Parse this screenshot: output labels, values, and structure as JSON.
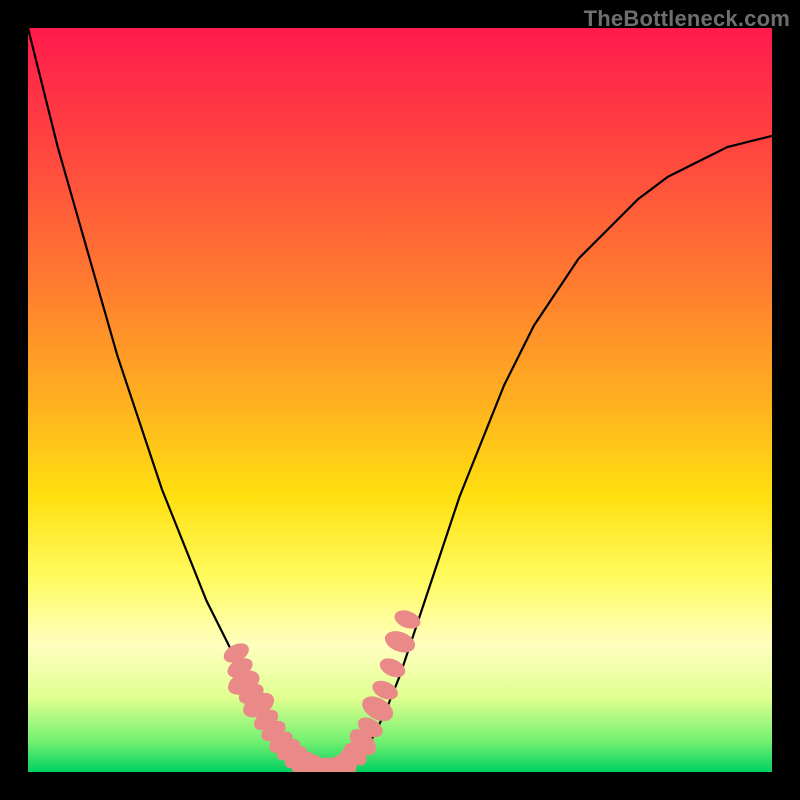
{
  "watermark": "TheBottleneck.com",
  "colors": {
    "frame": "#000000",
    "curve": "#000000",
    "marker": "#e98a88",
    "gradient_stops": [
      "#ff1a4d",
      "#ff4a3e",
      "#ff7a30",
      "#ffb020",
      "#ffe010",
      "#fffb60",
      "#ffffc0",
      "#e0ff90",
      "#70f070",
      "#00d060"
    ]
  },
  "chart_data": {
    "type": "line",
    "title": "",
    "xlabel": "",
    "ylabel": "",
    "xlim": [
      0,
      100
    ],
    "ylim": [
      0,
      100
    ],
    "x": [
      0,
      2,
      4,
      6,
      8,
      10,
      12,
      14,
      16,
      18,
      20,
      22,
      24,
      26,
      28,
      30,
      32,
      34,
      36,
      38,
      40,
      42,
      44,
      46,
      48,
      50,
      52,
      54,
      56,
      58,
      60,
      62,
      64,
      66,
      68,
      70,
      72,
      74,
      76,
      78,
      80,
      82,
      84,
      86,
      88,
      90,
      92,
      94,
      96,
      98,
      100
    ],
    "series": [
      {
        "name": "bottleneck-curve",
        "values": [
          100,
          92,
          84,
          77,
          70,
          63,
          56,
          50,
          44,
          38,
          33,
          28,
          23,
          19,
          15,
          11,
          8,
          5,
          3,
          1,
          0,
          0,
          1,
          4,
          8,
          13,
          19,
          25,
          31,
          37,
          42,
          47,
          52,
          56,
          60,
          63,
          66,
          69,
          71,
          73,
          75,
          77,
          78.5,
          80,
          81,
          82,
          83,
          84,
          84.5,
          85,
          85.5
        ]
      }
    ],
    "markers": [
      {
        "x": 28,
        "y": 16,
        "size": 1.2
      },
      {
        "x": 28.5,
        "y": 14,
        "size": 1.2
      },
      {
        "x": 29,
        "y": 12,
        "size": 1.5
      },
      {
        "x": 30,
        "y": 10.5,
        "size": 1.2
      },
      {
        "x": 31,
        "y": 9,
        "size": 1.5
      },
      {
        "x": 32,
        "y": 7,
        "size": 1.2
      },
      {
        "x": 33,
        "y": 5.5,
        "size": 1.2
      },
      {
        "x": 34,
        "y": 4,
        "size": 1.2
      },
      {
        "x": 35,
        "y": 3,
        "size": 1.2
      },
      {
        "x": 36,
        "y": 2,
        "size": 1.2
      },
      {
        "x": 37,
        "y": 1.2,
        "size": 1.2
      },
      {
        "x": 38,
        "y": 0.7,
        "size": 1.2
      },
      {
        "x": 39,
        "y": 0.3,
        "size": 1.2
      },
      {
        "x": 40,
        "y": 0.2,
        "size": 1.2
      },
      {
        "x": 41,
        "y": 0.2,
        "size": 1.2
      },
      {
        "x": 42,
        "y": 0.5,
        "size": 1.2
      },
      {
        "x": 43,
        "y": 1.3,
        "size": 1.2
      },
      {
        "x": 44,
        "y": 2.4,
        "size": 1.2
      },
      {
        "x": 45,
        "y": 4,
        "size": 1.4
      },
      {
        "x": 46,
        "y": 6,
        "size": 1.2
      },
      {
        "x": 47,
        "y": 8.5,
        "size": 1.5
      },
      {
        "x": 48,
        "y": 11,
        "size": 1.2
      },
      {
        "x": 49,
        "y": 14,
        "size": 1.2
      },
      {
        "x": 50,
        "y": 17.5,
        "size": 1.4
      },
      {
        "x": 51,
        "y": 20.5,
        "size": 1.2
      }
    ]
  }
}
